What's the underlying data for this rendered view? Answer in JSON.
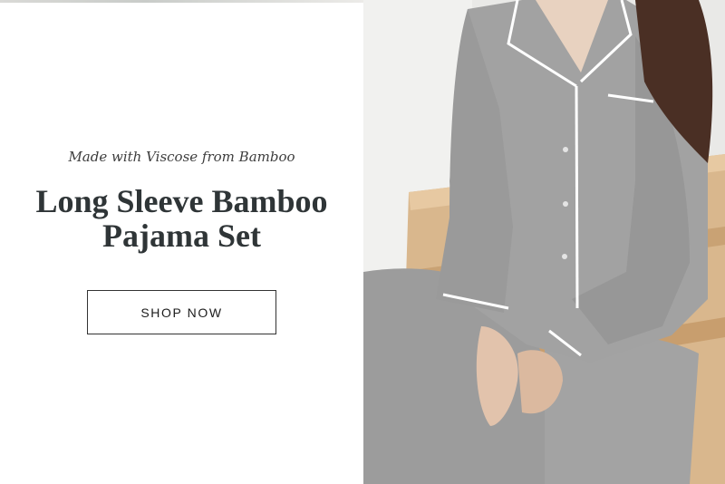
{
  "promo": {
    "eyebrow": "Made with Viscose from Bamboo",
    "title_line1": "Long Sleeve Bamboo",
    "title_line2": "Pajama Set",
    "cta_label": "SHOP NOW"
  },
  "colors": {
    "title_text": "#2f3537",
    "button_border": "#333333",
    "pajama_gray": "#9b9b9b",
    "piping": "#ffffff",
    "wood_stairs": "#d7b48a"
  }
}
